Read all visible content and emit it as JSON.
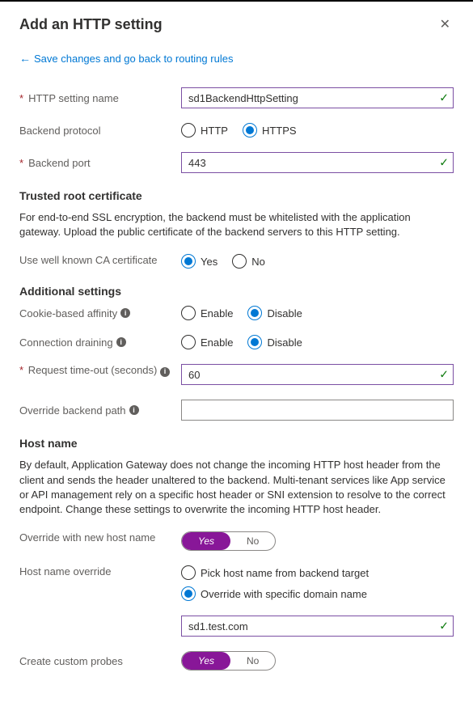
{
  "header": {
    "title": "Add an HTTP setting"
  },
  "backLink": "Save changes and go back to routing rules",
  "fields": {
    "httpSettingName": {
      "label": "HTTP setting name",
      "value": "sd1BackendHttpSetting"
    },
    "backendProtocol": {
      "label": "Backend protocol",
      "options": {
        "http": "HTTP",
        "https": "HTTPS"
      }
    },
    "backendPort": {
      "label": "Backend port",
      "value": "443"
    },
    "useWellKnownCA": {
      "label": "Use well known CA certificate",
      "options": {
        "yes": "Yes",
        "no": "No"
      }
    },
    "cookieAffinity": {
      "label": "Cookie-based affinity",
      "options": {
        "enable": "Enable",
        "disable": "Disable"
      }
    },
    "connectionDraining": {
      "label": "Connection draining",
      "options": {
        "enable": "Enable",
        "disable": "Disable"
      }
    },
    "requestTimeout": {
      "label": "Request time-out (seconds)",
      "value": "60"
    },
    "overrideBackendPath": {
      "label": "Override backend path",
      "value": ""
    },
    "overrideNewHost": {
      "label": "Override with new host name",
      "options": {
        "yes": "Yes",
        "no": "No"
      }
    },
    "hostNameOverride": {
      "label": "Host name override",
      "options": {
        "pick": "Pick host name from backend target",
        "specific": "Override with specific domain name"
      },
      "value": "sd1.test.com"
    },
    "createCustomProbes": {
      "label": "Create custom probes",
      "options": {
        "yes": "Yes",
        "no": "No"
      }
    }
  },
  "sections": {
    "trustedRoot": {
      "heading": "Trusted root certificate",
      "desc": "For end-to-end SSL encryption, the backend must be whitelisted with the application gateway. Upload the public certificate of the backend servers to this HTTP setting."
    },
    "additional": {
      "heading": "Additional settings"
    },
    "hostName": {
      "heading": "Host name",
      "desc": "By default, Application Gateway does not change the incoming HTTP host header from the client and sends the header unaltered to the backend. Multi-tenant services like App service or API management rely on a specific host header or SNI extension to resolve to the correct endpoint. Change these settings to overwrite the incoming HTTP host header."
    }
  }
}
